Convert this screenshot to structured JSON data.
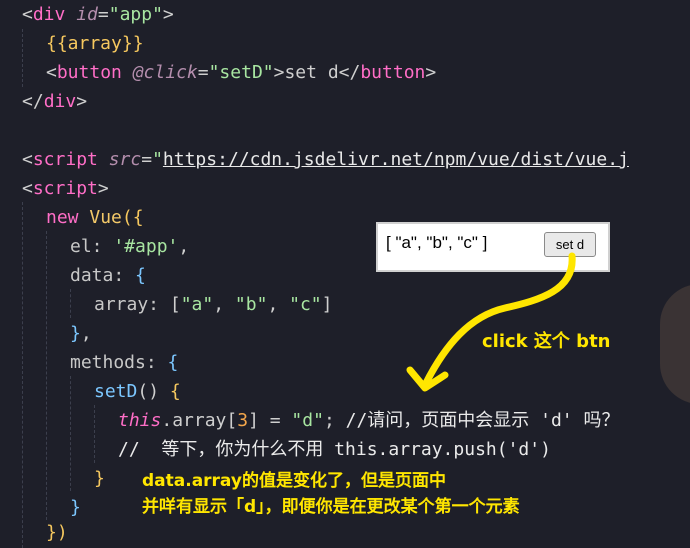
{
  "code": {
    "l1": {
      "lt": "<",
      "tag": "div",
      "attr": "id",
      "eq": "=",
      "val": "\"app\"",
      "gt": ">"
    },
    "l2": {
      "text": "{{array}}"
    },
    "l3": {
      "lt": "<",
      "tag": "button",
      "attr": "@click",
      "eq": "=",
      "val": "\"setD\"",
      "gt": ">",
      "inner": "set d",
      "close_lt": "</",
      "close_tag": "button",
      "close_gt": ">"
    },
    "l4": {
      "lt": "</",
      "tag": "div",
      "gt": ">"
    },
    "l6": {
      "lt": "<",
      "tag": "script",
      "attr": "src",
      "eq": "=",
      "q": "\"",
      "url": "https://cdn.jsdelivr.net/npm/vue/dist/vue.j"
    },
    "l7": {
      "lt": "<",
      "tag": "script",
      "gt": ">"
    },
    "l8": {
      "kw": "new",
      "cls": "Vue",
      "open": "({"
    },
    "l9": {
      "key": "el:",
      "val": "'#app'",
      "comma": ","
    },
    "l10": {
      "key": "data:",
      "brace": "{"
    },
    "l11": {
      "key": "array:",
      "open": "[",
      "a": "\"a\"",
      "c1": ", ",
      "b": "\"b\"",
      "c2": ", ",
      "c": "\"c\"",
      "close": "]"
    },
    "l12": {
      "brace": "}",
      "comma": ","
    },
    "l13": {
      "key": "methods:",
      "brace": "{"
    },
    "l14": {
      "fn": "setD",
      "paren": "()",
      "brace": "{"
    },
    "l15": {
      "this": "this",
      "rest1": ".array[",
      "idx": "3",
      "rest2": "] = ",
      "val": "\"d\"",
      "semi": ";",
      "comment": " //请问，页面中会显示 'd' 吗？"
    },
    "l16": {
      "comment": "//  等下，你为什么不用 this.array.push('d')"
    },
    "l17": {
      "brace": "}"
    },
    "l18": {
      "brace": "}"
    },
    "l19": {
      "close": "})"
    }
  },
  "preview": {
    "array_text": "[ \"a\", \"b\", \"c\" ]",
    "button_label": "set d"
  },
  "annotations": {
    "click_note": "click 这个 btn",
    "explain_line1": "data.array的值是变化了，但是页面中",
    "explain_line2": "并咩有显示「d」，即便你是在更改某个第一个元素"
  },
  "colors": {
    "background": "#1e1f29",
    "tag": "#ff6ec7",
    "string": "#a8e6a1",
    "annotation": "#ffe600"
  }
}
